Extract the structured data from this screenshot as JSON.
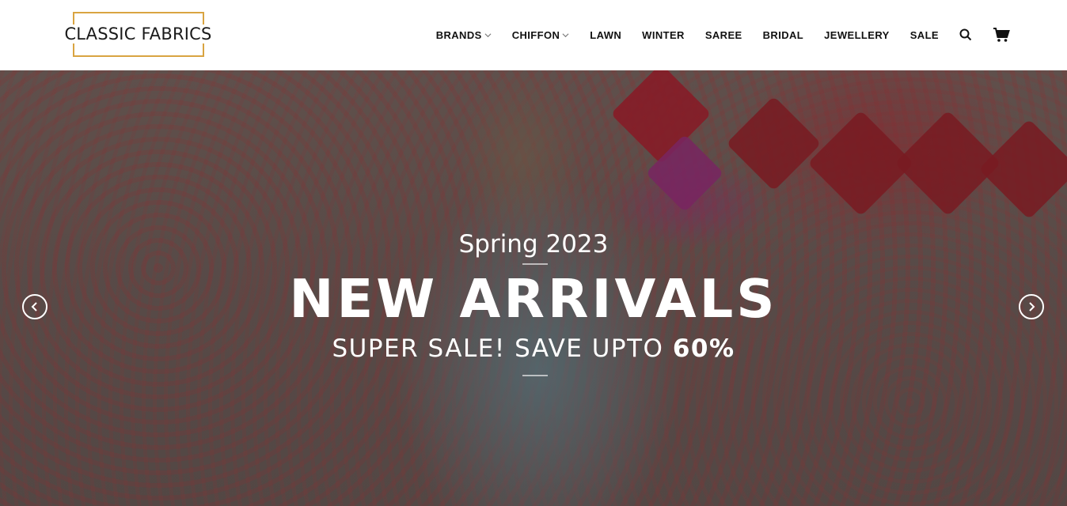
{
  "brand": {
    "logo_text": "CLASSIC FABRICS",
    "accent": "#d9a441"
  },
  "nav": {
    "items": [
      {
        "label": "BRANDS",
        "has_dropdown": true
      },
      {
        "label": "CHIFFON",
        "has_dropdown": true
      },
      {
        "label": "LAWN",
        "has_dropdown": false
      },
      {
        "label": "WINTER",
        "has_dropdown": false
      },
      {
        "label": "SAREE",
        "has_dropdown": false
      },
      {
        "label": "BRIDAL",
        "has_dropdown": false
      },
      {
        "label": "JEWELLERY",
        "has_dropdown": false
      },
      {
        "label": "SALE",
        "has_dropdown": false
      }
    ],
    "icons": [
      "search-icon",
      "cart-icon"
    ]
  },
  "hero": {
    "subtitle": "Spring 2023",
    "headline": "NEW ARRIVALS",
    "sale_text": "SUPER SALE! SAVE UPTO",
    "sale_percent": "60%",
    "prev_icon": "chevron-left-icon",
    "next_icon": "chevron-right-icon"
  }
}
